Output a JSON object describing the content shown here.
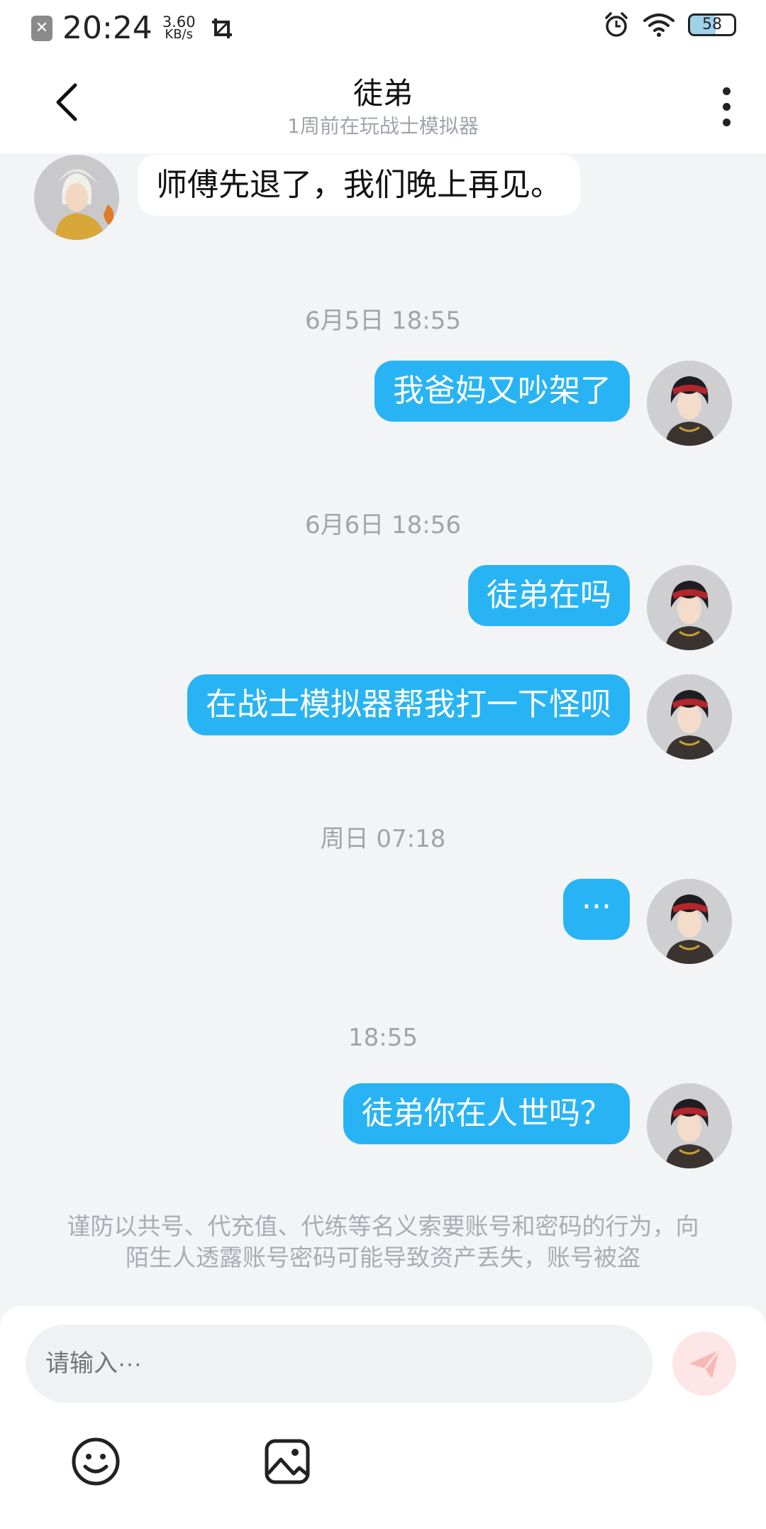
{
  "status_bar": {
    "time": "20:24",
    "speed_value": "3.60",
    "speed_unit": "KB/s",
    "battery": "58",
    "icons": [
      "notification-x-icon",
      "screenshot-icon",
      "alarm-icon",
      "wifi-icon",
      "battery-icon"
    ]
  },
  "header": {
    "title": "徒弟",
    "subtitle": "1周前在玩战士模拟器",
    "back_icon": "chevron-left-icon",
    "more_icon": "more-vertical-icon"
  },
  "messages": [
    {
      "side": "in",
      "text": "师傅先退了，我们晚上再见。",
      "avatar": "avatar-master"
    },
    {
      "time": "6月5日 18:55"
    },
    {
      "side": "out",
      "text": "我爸妈又吵架了",
      "avatar": "avatar-self"
    },
    {
      "time": "6月6日 18:56"
    },
    {
      "side": "out",
      "text": "徒弟在吗",
      "avatar": "avatar-self"
    },
    {
      "side": "out",
      "text": "在战士模拟器帮我打一下怪呗",
      "avatar": "avatar-self"
    },
    {
      "time": "周日 07:18"
    },
    {
      "side": "out",
      "text": "···",
      "avatar": "avatar-self"
    },
    {
      "time": "18:55"
    },
    {
      "side": "out",
      "text": "徒弟你在人世吗？",
      "avatar": "avatar-self"
    }
  ],
  "notice": "谨防以共号、代充值、代练等名义索要账号和密码的行为，向陌生人透露账号密码可能导致资产丢失，账号被盗",
  "composer": {
    "placeholder": "请输入···",
    "send_icon": "send-icon",
    "emoji_icon": "emoji-icon",
    "image_icon": "image-icon"
  },
  "colors": {
    "outgoing_bubble": "#28b4f4",
    "incoming_bubble": "#ffffff",
    "background": "#f3f4f6",
    "send_button_disabled": "#fde6e5"
  }
}
